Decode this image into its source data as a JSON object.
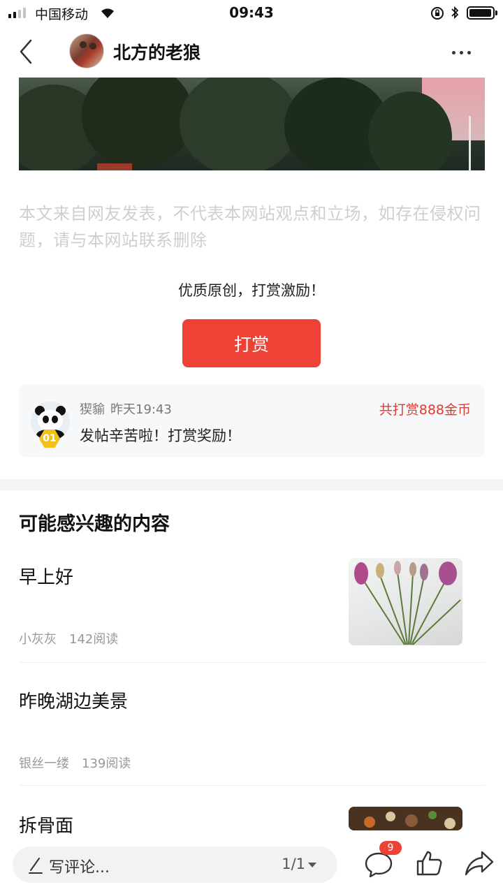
{
  "status_bar": {
    "carrier": "中国移动",
    "time": "09:43"
  },
  "nav": {
    "author_name": "北方的老狼",
    "icons": [
      "back-icon",
      "more-icon"
    ]
  },
  "article": {
    "disclaimer": "本文来自网友发表，不代表本网站观点和立场，如存在侵权问题，请与本网站联系删除",
    "reward_prompt": "优质原创，打赏激励！",
    "reward_button": "打赏"
  },
  "reward_card": {
    "donor_name": "猰貐",
    "time": "昨天19:43",
    "total": "共打赏888金币",
    "message": "发帖辛苦啦！打赏奖励！",
    "rank": "01"
  },
  "recommendations": {
    "title": "可能感兴趣的内容",
    "items": [
      {
        "title": "早上好",
        "author": "小灰灰",
        "reads": "142阅读"
      },
      {
        "title": "昨晚湖边美景",
        "author": "银丝一缕",
        "reads": "139阅读"
      },
      {
        "title": "拆骨面"
      }
    ]
  },
  "bottom_bar": {
    "comment_placeholder": "写评论...",
    "page_indicator": "1/1",
    "comment_count": "9"
  },
  "colors": {
    "accent": "#ee4236",
    "reward_total": "#e23a2f",
    "disclaimer_text": "#cfcfcf"
  }
}
